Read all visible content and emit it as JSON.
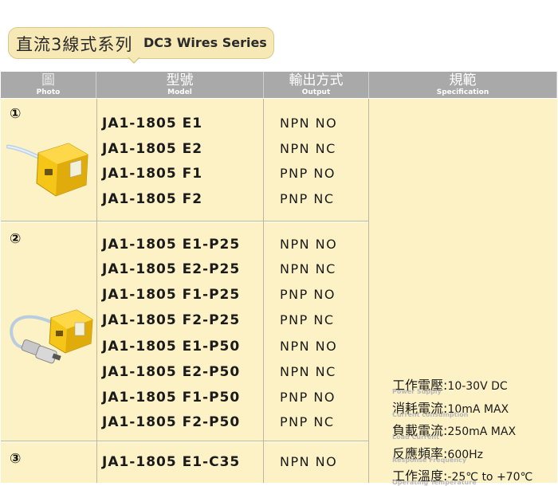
{
  "title": {
    "cn": "直流3線式系列",
    "en": "DC3 Wires Series"
  },
  "headers": {
    "photo": {
      "cn": "圖",
      "en": "Photo"
    },
    "model": {
      "cn": "型號",
      "en": "Model"
    },
    "output": {
      "cn": "輸出方式",
      "en": "Output"
    },
    "spec": {
      "cn": "規範",
      "en": "Specification"
    }
  },
  "groups": [
    {
      "num": "①",
      "models": [
        "JA1-1805 E1",
        "JA1-1805 E2",
        "JA1-1805 F1",
        "JA1-1805 F2"
      ],
      "outputs": [
        "NPN NO",
        "NPN NC",
        "PNP NO",
        "PNP NC"
      ]
    },
    {
      "num": "②",
      "models": [
        "JA1-1805 E1-P25",
        "JA1-1805 E2-P25",
        "JA1-1805 F1-P25",
        "JA1-1805 F2-P25",
        "JA1-1805 E1-P50",
        "JA1-1805 E2-P50",
        "JA1-1805 F1-P50",
        "JA1-1805 F2-P50"
      ],
      "outputs": [
        "NPN NO",
        "NPN NC",
        "PNP NO",
        "PNP NC",
        "NPN NO",
        "NPN NC",
        "PNP NO",
        "PNP NC"
      ]
    },
    {
      "num": "③",
      "models": [
        "JA1-1805 E1-C35"
      ],
      "outputs": [
        "NPN NO"
      ]
    }
  ],
  "spec": [
    {
      "cn": "工作電壓",
      "val": "10-30V DC",
      "en": "Power Supply"
    },
    {
      "cn": "消耗電流",
      "val": "10mA MAX",
      "en": "Current consumption"
    },
    {
      "cn": "負載電流",
      "val": "250mA MAX",
      "en": "Load Current"
    },
    {
      "cn": "反應頻率",
      "val": "600Hz",
      "en": "Response Frequency"
    },
    {
      "cn": "工作溫度",
      "val": "-25℃ to +70℃",
      "en": "Operating Temperature"
    }
  ],
  "colors": {
    "header": "#a9a9a9",
    "cell": "#fdf1c6",
    "pill": "#f7e9b6",
    "sensor": "#f5c518"
  },
  "icons": [
    "proximity-sensor-cable-icon",
    "proximity-sensor-connector-icon"
  ]
}
